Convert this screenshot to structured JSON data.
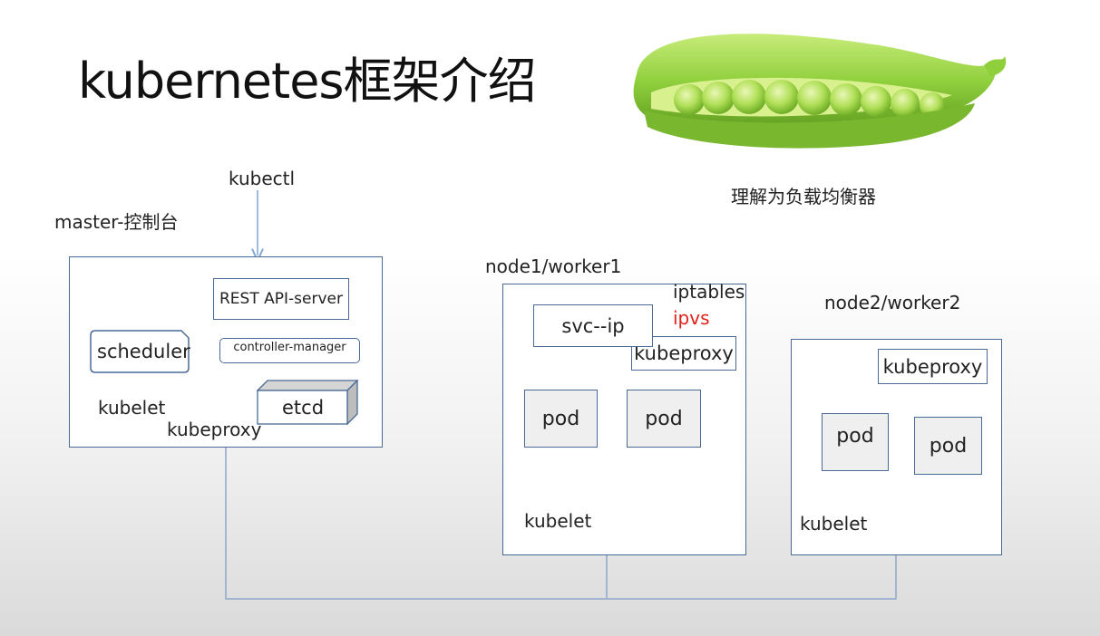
{
  "slide": {
    "title": "kubernetes框架介绍",
    "pea_caption": "理解为负载均衡器"
  },
  "diagram": {
    "kubectl": "kubectl",
    "master": {
      "label": "master-控制台",
      "api_server": "REST API-server",
      "scheduler": "scheduler",
      "controller_manager": "controller-manager",
      "kubelet": "kubelet",
      "etcd": "etcd",
      "kubeproxy": "kubeproxy"
    },
    "node1": {
      "label": "node1/worker1",
      "iptables": "iptables",
      "ipvs": "ipvs",
      "svc_ip": "svc--ip",
      "kubeproxy": "kubeproxy",
      "pod1": "pod",
      "pod2": "pod",
      "kubelet": "kubelet"
    },
    "node2": {
      "label": "node2/worker2",
      "kubeproxy": "kubeproxy",
      "pod1": "pod",
      "pod2": "pod",
      "kubelet": "kubelet"
    }
  },
  "colors": {
    "box_border": "#4a6a95",
    "arrow": "#7ea6d6",
    "ipvs_text": "#e0201b",
    "pod_fill": "#efefef",
    "pea_green": "#8fcf3c"
  },
  "icons": {
    "pea_image": "pea-pod-icon"
  }
}
